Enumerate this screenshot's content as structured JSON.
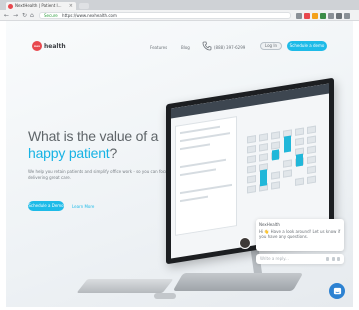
{
  "browser": {
    "tab_title": "NextHealth | Patient I...",
    "url_secure_label": "Secure",
    "url": "https://www.nexhealth.com",
    "nav": {
      "back_icon": "arrow-left-icon",
      "forward_icon": "arrow-right-icon",
      "reload_icon": "reload-icon",
      "home_icon": "home-icon"
    },
    "extension_colors": [
      "#8a9096",
      "#e8484e",
      "#f4a21d",
      "#3b8d47",
      "#8a9096",
      "#6d7378",
      "#8a9096"
    ]
  },
  "header": {
    "logo_mark": "nex",
    "logo_text": "health",
    "nav_features": "Features",
    "nav_blog": "Blog",
    "phone": "(888) 397-6299",
    "login": "Log In",
    "schedule_demo": "Schedule a demo"
  },
  "hero": {
    "line1": "What is the value of a",
    "line2": "happy patient",
    "line2_q": "?",
    "subtitle": "We help you retain patients and simplify office work - so you can focus on delivering great care.",
    "cta": "Schedule a Demo",
    "learn_more": "Learn More"
  },
  "chat": {
    "sender": "NexHealth",
    "message_hi": "Hi",
    "message_wave": "👋",
    "message": "Have a look around! Let us know if you have any questions.",
    "placeholder": "Write a reply...",
    "launcher_icon": "chat-bubble-icon"
  },
  "colors": {
    "brand_red": "#e8484e",
    "accent_blue": "#1ebbe8",
    "launcher_blue": "#2d82d2"
  }
}
